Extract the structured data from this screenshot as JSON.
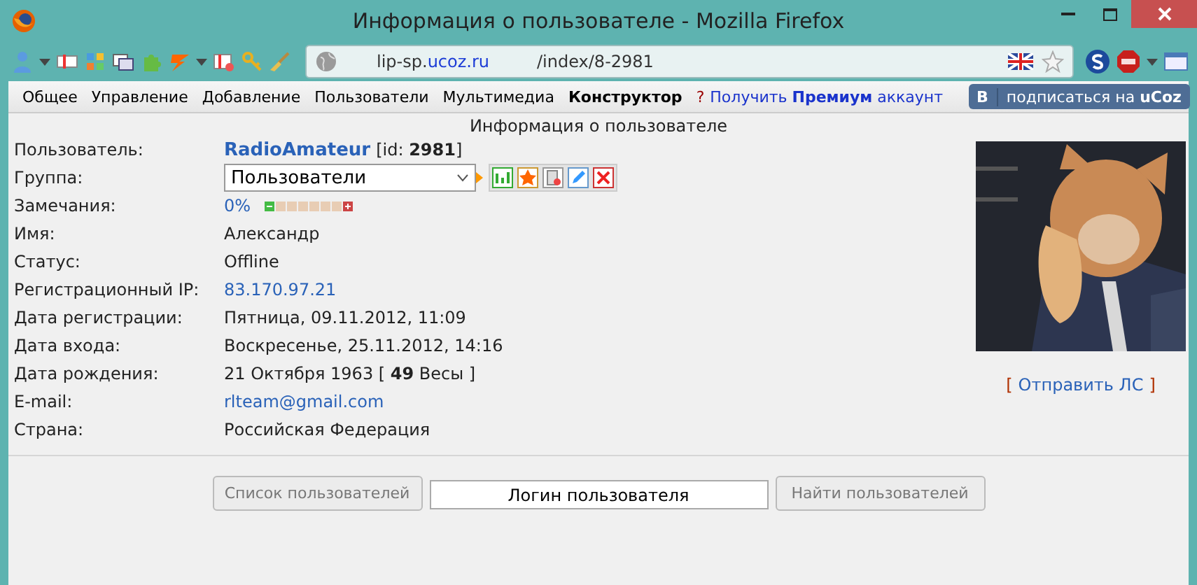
{
  "window": {
    "title": "Информация о пользователе - Mozilla Firefox"
  },
  "address": {
    "host": [
      "lip-sp.",
      "ucoz.ru"
    ],
    "path": "/index/8-2981"
  },
  "nav": {
    "items": [
      {
        "label": "Общее",
        "selected": false
      },
      {
        "label": "Управление",
        "selected": false
      },
      {
        "label": "Добавление",
        "selected": false
      },
      {
        "label": "Пользователи",
        "selected": false
      },
      {
        "label": "Мультимедиа",
        "selected": false
      },
      {
        "label": "Конструктор",
        "selected": true
      }
    ],
    "help": "?",
    "premium": "Получить **Премиум** аккаунт",
    "vk_letter": "В",
    "subscribe": "подписаться на **uCoz**"
  },
  "page_title": "Информация о пользователе",
  "rows": [
    {
      "kind": "user",
      "label": "Пользователь:",
      "value": "RadioAmateur",
      "extra": "[id: **2981**]"
    },
    {
      "kind": "select",
      "label": "Группа:",
      "value": "Пользователи"
    },
    {
      "kind": "meter",
      "label": "Замечания:",
      "value": "0%",
      "level": 0
    },
    {
      "kind": "text",
      "label": "Имя:",
      "value": "Александр"
    },
    {
      "kind": "text",
      "label": "Статус:",
      "value": "Offline"
    },
    {
      "kind": "link",
      "label": "Регистрационный IP:",
      "value": "83.170.97.21"
    },
    {
      "kind": "text",
      "label": "Дата регистрации:",
      "value": "Пятница, 09.11.2012, 11:09"
    },
    {
      "kind": "text",
      "label": "Дата входа:",
      "value": "Воскресенье, 25.11.2012, 14:16"
    },
    {
      "kind": "rich",
      "label": "Дата рождения:",
      "value": "21 Октября 1963 [ **49** Весы ]"
    },
    {
      "kind": "link",
      "label": "E-mail:",
      "value": "rlteam@gmail.com"
    },
    {
      "kind": "text",
      "label": "Страна:",
      "value": "Российская Федерация"
    }
  ],
  "send_message": {
    "open": "[",
    "label": "Отправить ЛС",
    "close": "]"
  },
  "search": {
    "list_button": {
      "label": "Список пользователей",
      "disabled": true
    },
    "login_value": "Логин пользователя",
    "find_button": {
      "label": "Найти пользователей",
      "disabled": true
    }
  }
}
